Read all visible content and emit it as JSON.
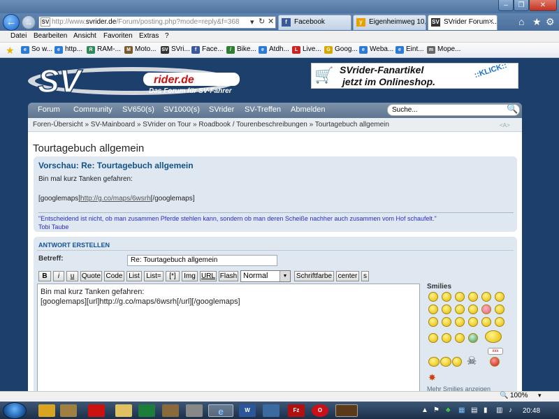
{
  "browser": {
    "address": {
      "prefix": "http://www.",
      "host": "svrider.de",
      "path": "/Forum/posting.php?mode=reply&f=368"
    },
    "addr_controls": {
      "dropdown": "▾",
      "refresh": "↻",
      "stop": "✕"
    },
    "tabs": [
      {
        "label": "Facebook",
        "icon": "f",
        "color": "#3b5998"
      },
      {
        "label": "Eigenheimweg 10,...",
        "icon": "y",
        "color": "#e9a100"
      },
      {
        "label": "SVrider Forum ...",
        "icon": "SV",
        "color": "#333333"
      }
    ],
    "menu": [
      "Datei",
      "Bearbeiten",
      "Ansicht",
      "Favoriten",
      "Extras",
      "?"
    ],
    "favorites": [
      {
        "label": "So w...",
        "color": "#2b7bd6"
      },
      {
        "label": "http...",
        "color": "#2b7bd6"
      },
      {
        "label": "RAM-...",
        "color": "#2e8b57"
      },
      {
        "label": "Moto...",
        "color": "#7a5a2a"
      },
      {
        "label": "SVri...",
        "color": "#333333"
      },
      {
        "label": "Face...",
        "color": "#3b5998"
      },
      {
        "label": "Bike...",
        "color": "#2e7d32"
      },
      {
        "label": "Atdh...",
        "color": "#2b7bd6"
      },
      {
        "label": "Live...",
        "color": "#cc2222"
      },
      {
        "label": "Goog...",
        "color": "#d6a800"
      },
      {
        "label": "Weba...",
        "color": "#2b7bd6"
      },
      {
        "label": "Eint...",
        "color": "#2b7bd6"
      },
      {
        "label": "Mope...",
        "color": "#666666"
      }
    ],
    "zoom": "100%"
  },
  "site": {
    "logo_text": "SV",
    "logo_sub": "rider.de",
    "slogan": "Das Forum für SV-Fahrer",
    "banner_line1": "SVrider-Fanartikel",
    "banner_line2": "jetzt im Onlineshop.",
    "banner_klick": "::KLICK::",
    "nav": [
      "Forum",
      "Community",
      "SV650(s)",
      "SV1000(s)",
      "SVrider",
      "SV-Treffen",
      "Abmelden"
    ],
    "search_value": "Suche...",
    "breadcrumb": "Foren-Übersicht » SV-Mainboard » SVrider on Tour » Roadbook / Tourenbeschreibungen » Tourtagebuch allgemein",
    "crumb_right": "<A>"
  },
  "page": {
    "title": "Tourtagebuch allgemein",
    "preview": {
      "title": "Vorschau: Re: Tourtagebuch allgemein",
      "line1": "Bin mal kurz Tanken gefahren:",
      "gm_open": "[googlemaps]",
      "gm_link": "http://g.co/maps/6wsrh",
      "gm_close": "[/googlemaps]",
      "quote": "\"Entscheidend ist nicht, ob man zusammen Pferde stehlen kann, sondern ob man deren Scheiße nachher auch zusammen vom Hof schaufelt.\"",
      "author": "Tobi Taube"
    },
    "reply": {
      "header": "ANTWORT ERSTELLEN",
      "subject_label": "Betreff:",
      "subject_value": "Re: Tourtagebuch allgemein",
      "toolbar": [
        "B",
        "i",
        "u",
        "Quote",
        "Code",
        "List",
        "List=",
        "[*]",
        "Img",
        "URL",
        "Flash"
      ],
      "font_size": "Normal",
      "toolbar2": [
        "Schriftfarbe",
        "center",
        "s"
      ],
      "editor_line1": "Bin mal kurz Tanken gefahren:",
      "editor_line2": "",
      "editor_line3": "[googlemaps][url]http://g.co/maps/6wsrh[/url][/googlemaps]",
      "smilies_title": "Smilies",
      "more_smilies": "Mehr Smilies anzeigen"
    }
  },
  "taskbar": {
    "apps": [
      {
        "name": "explorer",
        "color": "#d9a520"
      },
      {
        "name": "adobe",
        "color": "#cc1111"
      },
      {
        "name": "notes",
        "color": "#e0c060"
      },
      {
        "name": "excel",
        "color": "#1d7d3a"
      },
      {
        "name": "gimp",
        "color": "#8a6a3a"
      },
      {
        "name": "ie",
        "color": "#2b7bd6"
      },
      {
        "name": "word",
        "color": "#2b579a"
      },
      {
        "name": "media",
        "color": "#3a6aa0"
      },
      {
        "name": "filezilla",
        "color": "#b01010"
      },
      {
        "name": "opera",
        "color": "#cc0f16"
      },
      {
        "name": "paint",
        "color": "#5a3a1a"
      }
    ],
    "time": "20:48"
  }
}
